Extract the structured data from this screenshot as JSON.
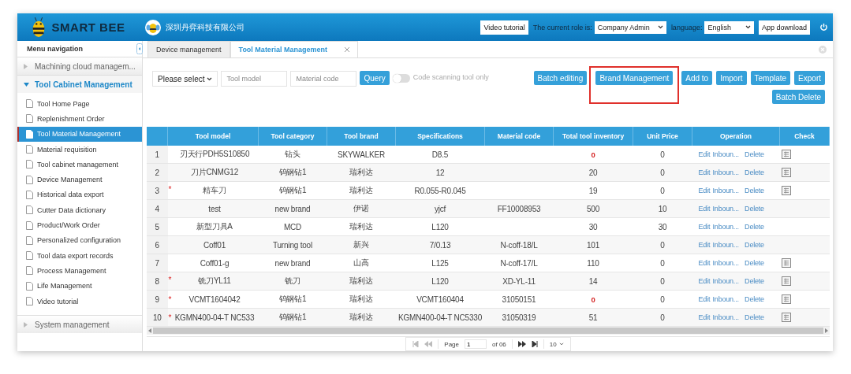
{
  "header": {
    "app_name": "SMART BEE",
    "company": "深圳丹弈科技有限公司",
    "video_button": "Video tutorial",
    "role_label": "The current role is:",
    "role_value": "Company Admin",
    "language_label": "language:",
    "language_value": "English",
    "download_button": "App download"
  },
  "sidebar": {
    "title": "Menu navigation",
    "groups": [
      {
        "label": "Machining cloud managem...",
        "expanded": false
      },
      {
        "label": "Tool Cabinet Management",
        "expanded": true,
        "children": [
          {
            "label": "Tool Home Page",
            "selected": false
          },
          {
            "label": "Replenishment Order",
            "selected": false
          },
          {
            "label": "Tool Material Management",
            "selected": true
          },
          {
            "label": "Material requisition",
            "selected": false
          },
          {
            "label": "Tool cabinet management",
            "selected": false
          },
          {
            "label": "Device Management",
            "selected": false
          },
          {
            "label": "Historical data export",
            "selected": false
          },
          {
            "label": "Cutter Data dictionary",
            "selected": false
          },
          {
            "label": "Product/Work Order",
            "selected": false
          },
          {
            "label": "Personalized configuration",
            "selected": false
          },
          {
            "label": "Tool data export records",
            "selected": false
          },
          {
            "label": "Process Management",
            "selected": false
          },
          {
            "label": "Life Management",
            "selected": false
          },
          {
            "label": "Video tutorial",
            "selected": false
          }
        ]
      },
      {
        "label": "System management",
        "expanded": false
      }
    ]
  },
  "tabs": [
    {
      "label": "Device management",
      "selected": false,
      "closable": false
    },
    {
      "label": "Tool Material Management",
      "selected": true,
      "closable": true
    }
  ],
  "filters": {
    "select_placeholder": "Please select",
    "model_placeholder": "Tool model",
    "code_placeholder": "Material code",
    "query_button": "Query",
    "toggle": {
      "label": "Code scanning tool only",
      "on": false
    }
  },
  "actions": [
    {
      "label": "Batch editing",
      "highlighted": false
    },
    {
      "label": "Brand Management",
      "highlighted": true
    },
    {
      "label": "Add to",
      "highlighted": false
    },
    {
      "label": "Import",
      "highlighted": false
    },
    {
      "label": "Template",
      "highlighted": false
    },
    {
      "label": "Export",
      "highlighted": false
    },
    {
      "label": "Batch Delete",
      "highlighted": false
    }
  ],
  "table": {
    "columns": [
      "Tool model",
      "Tool category",
      "Tool brand",
      "Specifications",
      "Material code",
      "Total tool inventory",
      "Unit Price",
      "Operation",
      "Check"
    ],
    "rows": [
      {
        "no": "1",
        "mark": "",
        "tool_model": "刃天行PDH5S10850",
        "category": "钻头",
        "brand": "SKYWALKER",
        "spec": "D8.5",
        "material_code": "",
        "inventory": "0",
        "low_stock": true,
        "unit_price": "0",
        "edit": "Edit",
        "inbound": "Inboun...",
        "delete": "Delete",
        "has_check": true
      },
      {
        "no": "2",
        "mark": "",
        "tool_model": "刀片CNMG12",
        "category": "钨钢钻1",
        "brand": "瑞利达",
        "spec": "12",
        "material_code": "",
        "inventory": "20",
        "low_stock": false,
        "unit_price": "0",
        "edit": "Edit",
        "inbound": "Inboun...",
        "delete": "Delete",
        "has_check": true
      },
      {
        "no": "3",
        "mark": "*",
        "tool_model": "精车刀",
        "category": "钨钢钻1",
        "brand": "瑞利达",
        "spec": "R0.055-R0.045",
        "material_code": "",
        "inventory": "19",
        "low_stock": false,
        "unit_price": "0",
        "edit": "Edit",
        "inbound": "Inboun...",
        "delete": "Delete",
        "has_check": true
      },
      {
        "no": "4",
        "mark": "",
        "tool_model": "test",
        "category": "new brand",
        "brand": "伊诺",
        "spec": "yjcf",
        "material_code": "FF10008953",
        "inventory": "500",
        "low_stock": false,
        "unit_price": "10",
        "edit": "Edit",
        "inbound": "Inboun...",
        "delete": "Delete",
        "has_check": false
      },
      {
        "no": "5",
        "mark": "",
        "tool_model": "新型刀具A",
        "category": "MCD",
        "brand": "瑞利达",
        "spec": "L120",
        "material_code": "",
        "inventory": "30",
        "low_stock": false,
        "unit_price": "30",
        "edit": "Edit",
        "inbound": "Inboun...",
        "delete": "Delete",
        "has_check": false
      },
      {
        "no": "6",
        "mark": "",
        "tool_model": "Coff01",
        "category": "Turning tool",
        "brand": "新兴",
        "spec": "7/0.13",
        "material_code": "N-coff-18/L",
        "inventory": "101",
        "low_stock": false,
        "unit_price": "0",
        "edit": "Edit",
        "inbound": "Inboun...",
        "delete": "Delete",
        "has_check": false
      },
      {
        "no": "7",
        "mark": "",
        "tool_model": "Coff01-g",
        "category": "new brand",
        "brand": "山高",
        "spec": "L125",
        "material_code": "N-coff-17/L",
        "inventory": "110",
        "low_stock": false,
        "unit_price": "0",
        "edit": "Edit",
        "inbound": "Inboun...",
        "delete": "Delete",
        "has_check": true
      },
      {
        "no": "8",
        "mark": "*",
        "tool_model": "铣刀YL11",
        "category": "铣刀",
        "brand": "瑞利达",
        "spec": "L120",
        "material_code": "XD-YL-11",
        "inventory": "14",
        "low_stock": false,
        "unit_price": "0",
        "edit": "Edit",
        "inbound": "Inboun...",
        "delete": "Delete",
        "has_check": true
      },
      {
        "no": "9",
        "mark": "*",
        "tool_model": "VCMT1604042",
        "category": "钨钢钻1",
        "brand": "瑞利达",
        "spec": "VCMT160404",
        "material_code": "31050151",
        "inventory": "0",
        "low_stock": true,
        "unit_price": "0",
        "edit": "Edit",
        "inbound": "Inboun...",
        "delete": "Delete",
        "has_check": true
      },
      {
        "no": "10",
        "mark": "*",
        "tool_model": "KGMN400-04-T NC533",
        "category": "钨钢钻1",
        "brand": "瑞利达",
        "spec": "KGMN400-04-T NC5330",
        "material_code": "31050319",
        "inventory": "51",
        "low_stock": false,
        "unit_price": "0",
        "edit": "Edit",
        "inbound": "Inboun...",
        "delete": "Delete",
        "has_check": true
      }
    ]
  },
  "pagination": {
    "page_label": "Page",
    "page": "1",
    "total": "of 06",
    "size": "10"
  }
}
